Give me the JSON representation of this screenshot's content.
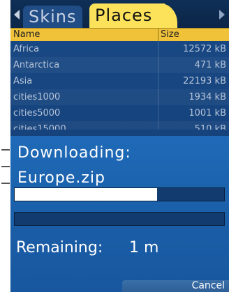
{
  "tabs": {
    "skins_label": "Skins",
    "places_label": "Places",
    "left_arrow_icon": "arrow-left-icon",
    "right_arrow_icon": "arrow-right-icon"
  },
  "table": {
    "headers": {
      "name": "Name",
      "size": "Size"
    },
    "rows": [
      {
        "name": "Africa",
        "size": "12572 kB"
      },
      {
        "name": "Antarctica",
        "size": "471 kB"
      },
      {
        "name": "Asia",
        "size": "22193 kB"
      },
      {
        "name": "cities1000",
        "size": "1934 kB"
      },
      {
        "name": "cities5000",
        "size": "1001 kB"
      },
      {
        "name": "cities15000",
        "size": "510 kB"
      }
    ]
  },
  "dialog": {
    "title": "Downloading:",
    "file": "Europe.zip",
    "progress_fraction": 0.68,
    "remaining_label": "Remaining:",
    "remaining_value": "1 m",
    "cancel_label": "Cancel"
  },
  "colors": {
    "tab_active": "#fbe25a",
    "header_bg": "#f0c23a",
    "dialog_bg": "#1f6ab8",
    "list_bg": "#16447e"
  }
}
